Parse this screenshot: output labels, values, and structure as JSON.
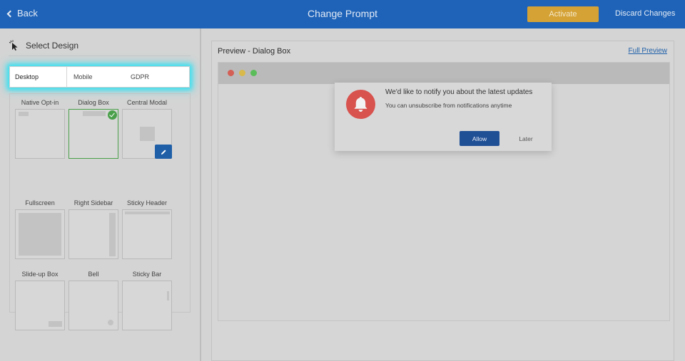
{
  "topbar": {
    "back_label": "Back",
    "title": "Change Prompt",
    "activate_label": "Activate",
    "discard_label": "Discard Changes"
  },
  "left": {
    "heading": "Select Design",
    "tabs": [
      {
        "label": "Desktop",
        "active": true
      },
      {
        "label": "Mobile",
        "active": false
      },
      {
        "label": "GDPR",
        "active": false
      }
    ],
    "designs": [
      {
        "label": "Native Opt-in",
        "selected": false
      },
      {
        "label": "Dialog Box",
        "selected": true
      },
      {
        "label": "Central Modal",
        "selected": false
      },
      {
        "label": "Fullscreen",
        "selected": false
      },
      {
        "label": "Right Sidebar",
        "selected": false
      },
      {
        "label": "Sticky Header",
        "selected": false
      },
      {
        "label": "Slide-up Box",
        "selected": false
      },
      {
        "label": "Bell",
        "selected": false
      },
      {
        "label": "Sticky Bar",
        "selected": false
      }
    ]
  },
  "preview": {
    "title": "Preview - Dialog Box",
    "full_preview_label": "Full Preview",
    "dialog": {
      "title": "We'd like to notify you about the latest updates",
      "subtitle": "You can unsubscribe from notifications anytime",
      "allow_label": "Allow",
      "later_label": "Later"
    }
  },
  "colors": {
    "topbar": "#1e63b8",
    "activate": "#d5a236",
    "selected_border": "#4aa04a",
    "tab_glow": "#40e0f0",
    "bell": "#d8524e",
    "allow": "#1f4f95"
  }
}
